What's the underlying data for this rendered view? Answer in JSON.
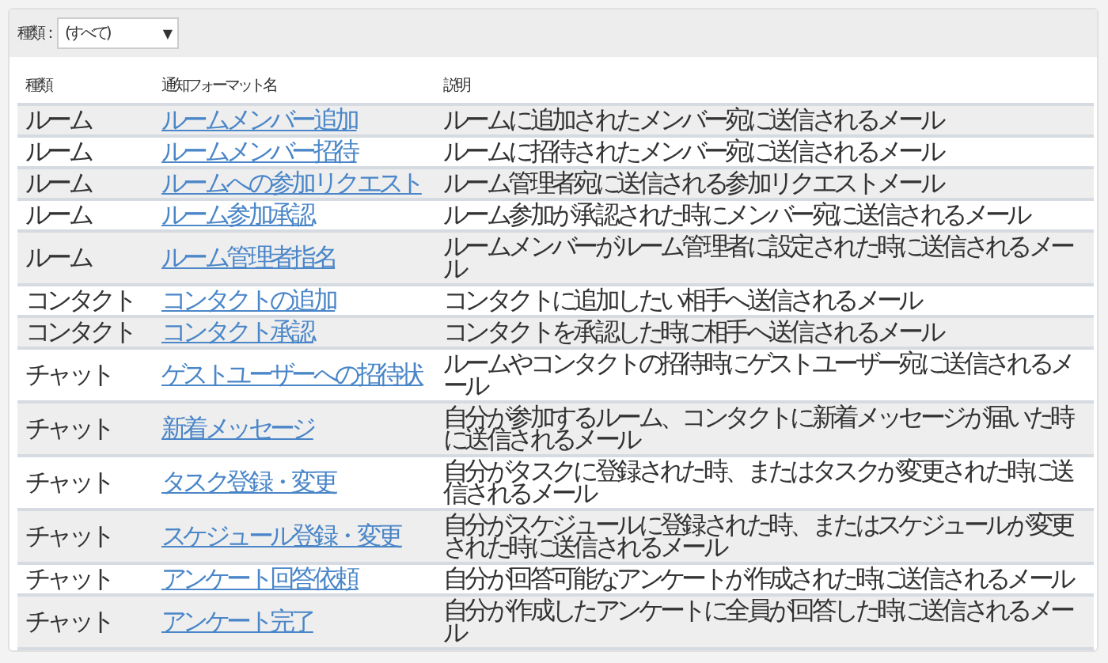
{
  "filter": {
    "label": "種類：",
    "value": "(すべて)",
    "caret": "▼"
  },
  "table": {
    "columns": [
      "種類",
      "通知フォーマット名",
      "説明"
    ],
    "rows": [
      {
        "type": "ルーム",
        "name": "ルームメンバー追加",
        "description": "ルームに追加されたメンバー宛に送信されるメール"
      },
      {
        "type": "ルーム",
        "name": "ルームメンバー招待",
        "description": "ルームに招待されたメンバー宛に送信されるメール"
      },
      {
        "type": "ルーム",
        "name": "ルームへの参加リクエスト",
        "description": "ルーム管理者宛に送信される参加リクエストメール"
      },
      {
        "type": "ルーム",
        "name": "ルーム参加承認",
        "description": "ルーム参加が承認された時にメンバー宛に送信されるメール"
      },
      {
        "type": "ルーム",
        "name": "ルーム管理者指名",
        "description": "ルームメンバーがルーム管理者に設定された時に送信されるメール"
      },
      {
        "type": "コンタクト",
        "name": "コンタクトの追加",
        "description": "コンタクトに追加したい相手へ送信されるメール"
      },
      {
        "type": "コンタクト",
        "name": "コンタクト承認",
        "description": "コンタクトを承認した時に相手へ送信されるメール"
      },
      {
        "type": "チャット",
        "name": "ゲストユーザーへの招待状",
        "description": "ルームやコンタクトの招待時にゲストユーザー宛に送信されるメール"
      },
      {
        "type": "チャット",
        "name": "新着メッセージ",
        "description": "自分が参加するルーム、コンタクトに新着メッセージが届いた時に送信されるメール"
      },
      {
        "type": "チャット",
        "name": "タスク登録・変更",
        "description": "自分がタスクに登録された時、またはタスクが変更された時に送信されるメール"
      },
      {
        "type": "チャット",
        "name": "スケジュール登録・変更",
        "description": "自分がスケジュールに登録された時、またはスケジュールが変更された時に送信されるメール"
      },
      {
        "type": "チャット",
        "name": "アンケート回答依頼",
        "description": "自分が回答可能なアンケートが作成された時に送信されるメール"
      },
      {
        "type": "チャット",
        "name": "アンケート完了",
        "description": "自分が作成したアンケートに全員が回答した時に送信されるメール"
      }
    ]
  }
}
